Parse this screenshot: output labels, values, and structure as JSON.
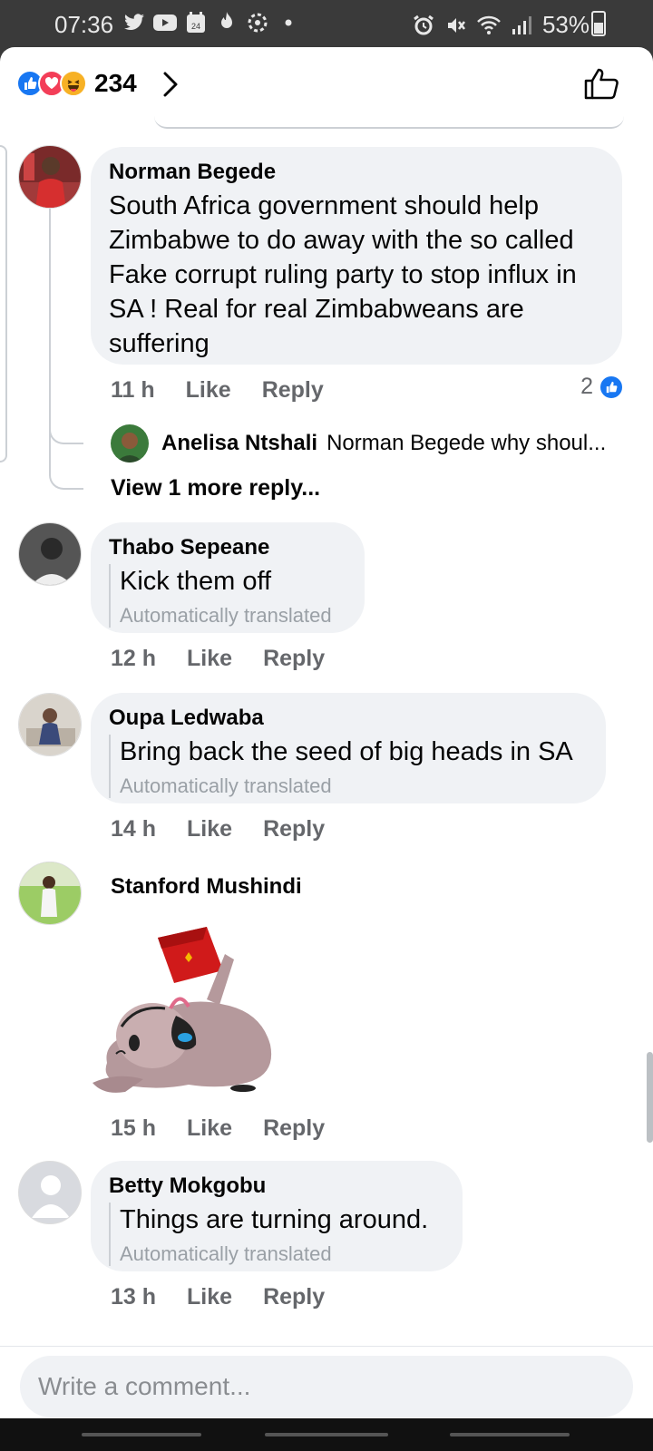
{
  "status_bar": {
    "time": "07:36",
    "battery": "53%",
    "left_icons": [
      "twitter-icon",
      "youtube-icon",
      "calendar-icon",
      "fire-icon",
      "settings-icon",
      "dot-icon"
    ],
    "right_icons": [
      "alarm-icon",
      "mute-icon",
      "wifi-icon",
      "signal-icon"
    ]
  },
  "header": {
    "reactions": [
      "like",
      "love",
      "haha"
    ],
    "reaction_count": "234"
  },
  "comments": [
    {
      "author": "Norman Begede",
      "text": "South Africa government should help Zimbabwe to do away with the so called Fake corrupt ruling party to stop influx in SA ! Real for real Zimbabweans are suffering",
      "time": "11 h",
      "like_label": "Like",
      "reply_label": "Reply",
      "likes": "2",
      "reply_preview": {
        "author": "Anelisa Ntshali",
        "text": "Norman Begede why shoul..."
      },
      "more_replies": "View 1 more reply..."
    },
    {
      "author": "Thabo Sepeane",
      "text": "Kick them off",
      "translated_note": "Automatically translated",
      "time": "12 h",
      "like_label": "Like",
      "reply_label": "Reply"
    },
    {
      "author": "Oupa Ledwaba",
      "text": "Bring back the seed of big heads in SA",
      "translated_note": "Automatically translated",
      "time": "14 h",
      "like_label": "Like",
      "reply_label": "Reply"
    },
    {
      "author": "Stanford Mushindi",
      "sticker": "sticker-image",
      "time": "15 h",
      "like_label": "Like",
      "reply_label": "Reply"
    },
    {
      "author": "Betty Mokgobu",
      "text": "Things are turning around.",
      "translated_note": "Automatically translated",
      "time": "13 h",
      "like_label": "Like",
      "reply_label": "Reply"
    }
  ],
  "composer": {
    "placeholder": "Write a comment..."
  },
  "colors": {
    "accent": "#1877f2",
    "bubble": "#f0f2f5",
    "muted_text": "#65676b"
  }
}
